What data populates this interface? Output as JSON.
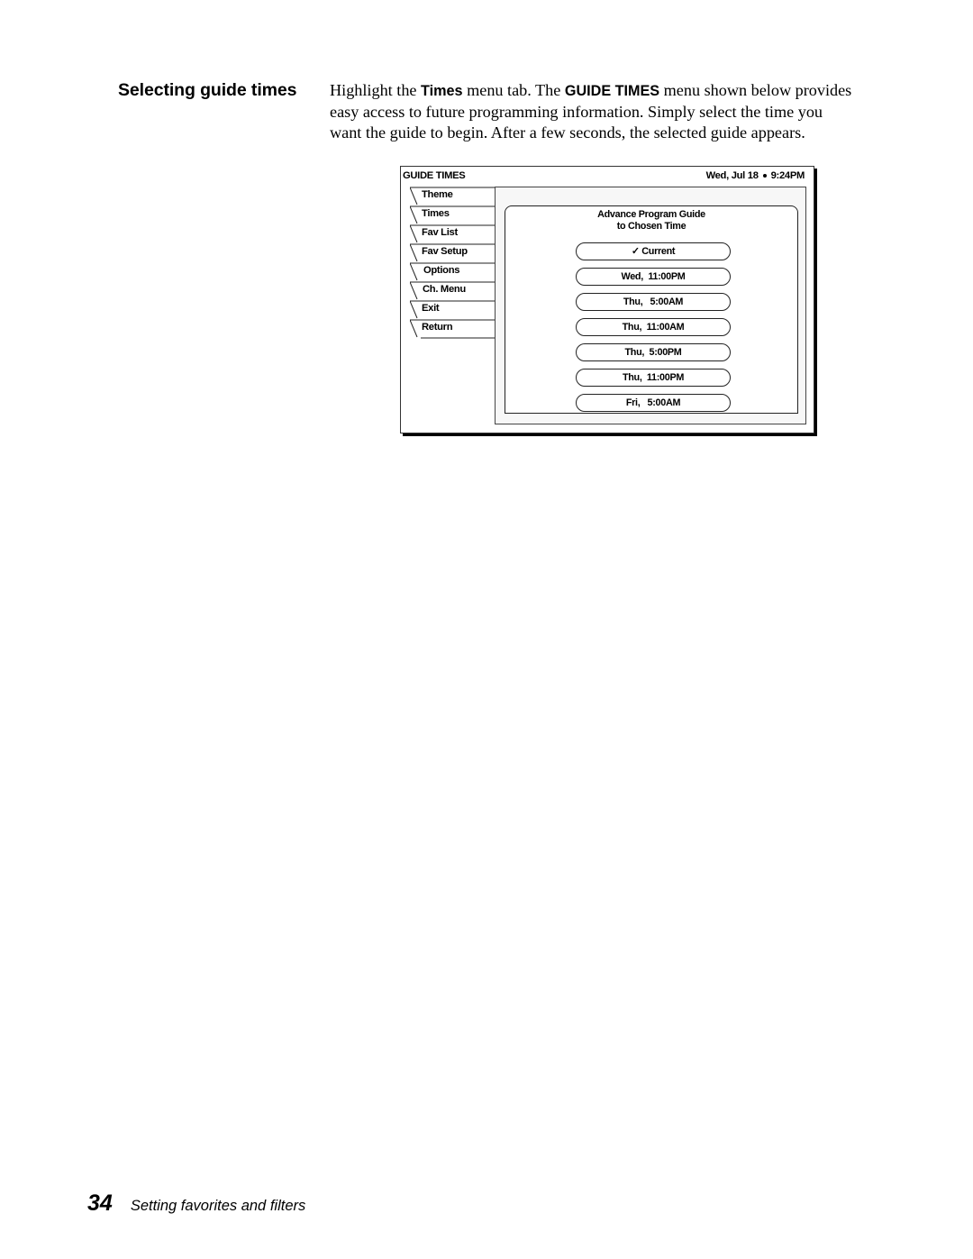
{
  "section_heading": "Selecting guide times",
  "body": {
    "line1": {
      "pre": "Highlight the ",
      "bold1": "Times",
      "mid": " menu tab. The ",
      "bold2": "GUIDE TIMES",
      "post": " menu shown below provides"
    },
    "line2": "easy access to future programming information. Simply select the time you",
    "line3": "want the guide to begin. After a few seconds, the selected guide appears."
  },
  "menu": {
    "title": "GUIDE TIMES",
    "date": "Wed, Jul 18",
    "time": "9:24PM",
    "tabs": [
      {
        "label": "Theme"
      },
      {
        "label": "Times"
      },
      {
        "label": "Fav List"
      },
      {
        "label": "Fav Setup"
      },
      {
        "label": "Options"
      },
      {
        "label": "Ch. Menu"
      },
      {
        "label": "Exit"
      },
      {
        "label": "Return"
      }
    ],
    "panel_heading_line1": "Advance Program Guide",
    "panel_heading_line2": "to Chosen Time",
    "options": [
      {
        "label": "✓ Current",
        "selected": true
      },
      {
        "label": "Wed,  11:00PM"
      },
      {
        "label": "Thu,   5:00AM"
      },
      {
        "label": "Thu,  11:00AM"
      },
      {
        "label": "Thu,  5:00PM"
      },
      {
        "label": "Thu,  11:00PM"
      },
      {
        "label": "Fri,   5:00AM"
      }
    ]
  },
  "footer": {
    "page_number": "34",
    "section_title": "Setting favorites and filters"
  }
}
